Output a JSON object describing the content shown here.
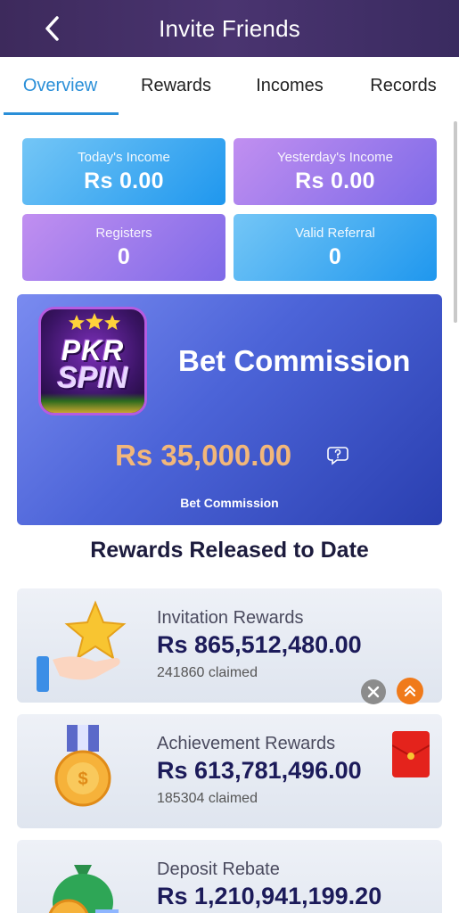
{
  "header": {
    "title": "Invite Friends",
    "back_icon": "chevron-left-icon"
  },
  "tabs": [
    {
      "label": "Overview",
      "active": true
    },
    {
      "label": "Rewards",
      "active": false
    },
    {
      "label": "Incomes",
      "active": false
    },
    {
      "label": "Records",
      "active": false
    }
  ],
  "stats": {
    "today_income": {
      "label": "Today's Income",
      "value": "Rs 0.00"
    },
    "yesterday_income": {
      "label": "Yesterday's Income",
      "value": "Rs 0.00"
    },
    "registers": {
      "label": "Registers",
      "value": "0"
    },
    "valid_referral": {
      "label": "Valid Referral",
      "value": "0"
    }
  },
  "commission": {
    "logo_line1": "PKR",
    "logo_line2": "SPIN",
    "title": "Bet Commission",
    "amount": "Rs 35,000.00",
    "subtitle": "Bet Commission",
    "help_icon": "question-bubble-icon"
  },
  "rewards_section": {
    "title": "Rewards Released to Date",
    "items": [
      {
        "name": "Invitation Rewards",
        "amount": "Rs 865,512,480.00",
        "claimed": "241860 claimed",
        "icon": "star-hand-icon"
      },
      {
        "name": "Achievement Rewards",
        "amount": "Rs 613,781,496.00",
        "claimed": "185304 claimed",
        "icon": "medal-icon"
      },
      {
        "name": "Deposit Rebate",
        "amount": "Rs 1,210,941,199.20",
        "claimed": "",
        "icon": "money-bag-icon"
      }
    ]
  },
  "floating": {
    "close_icon": "close-icon",
    "scroll_top_icon": "double-chevron-up-icon",
    "envelope_icon": "red-envelope-icon"
  },
  "colors": {
    "header": "#3d2a5c",
    "tab_active": "#2a8fd8",
    "commission_amount": "#f2b77a",
    "reward_amount": "#1c1b5a"
  }
}
